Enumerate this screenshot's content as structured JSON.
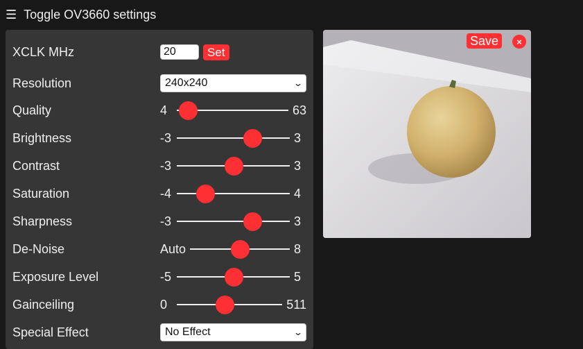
{
  "menu": {
    "toggle_label": "Toggle OV3660 settings",
    "icon": "hamburger-icon"
  },
  "settings": {
    "xclk": {
      "label": "XCLK MHz",
      "value": "20",
      "button_label": "Set"
    },
    "resolution": {
      "label": "Resolution",
      "selected": "240x240"
    },
    "quality": {
      "label": "Quality",
      "min": "4",
      "max": "63",
      "value": 10
    },
    "brightness": {
      "label": "Brightness",
      "min": "-3",
      "max": "3",
      "value": 1
    },
    "contrast": {
      "label": "Contrast",
      "min": "-3",
      "max": "3",
      "value": 0
    },
    "saturation": {
      "label": "Saturation",
      "min": "-4",
      "max": "4",
      "value": -2
    },
    "sharpness": {
      "label": "Sharpness",
      "min": "-3",
      "max": "3",
      "value": 1
    },
    "denoise": {
      "label": "De-Noise",
      "min": "Auto",
      "max": "8",
      "value": 4
    },
    "exposure": {
      "label": "Exposure Level",
      "min": "-5",
      "max": "5",
      "value": 0
    },
    "gainceiling": {
      "label": "Gainceiling",
      "min": "0",
      "max": "511",
      "value": 230
    },
    "special_effect": {
      "label": "Special Effect",
      "selected": "No Effect"
    }
  },
  "preview": {
    "save_label": "Save",
    "close_label": "×"
  },
  "colors": {
    "accent": "#ff3034",
    "panel": "#363636",
    "background": "#181818"
  }
}
